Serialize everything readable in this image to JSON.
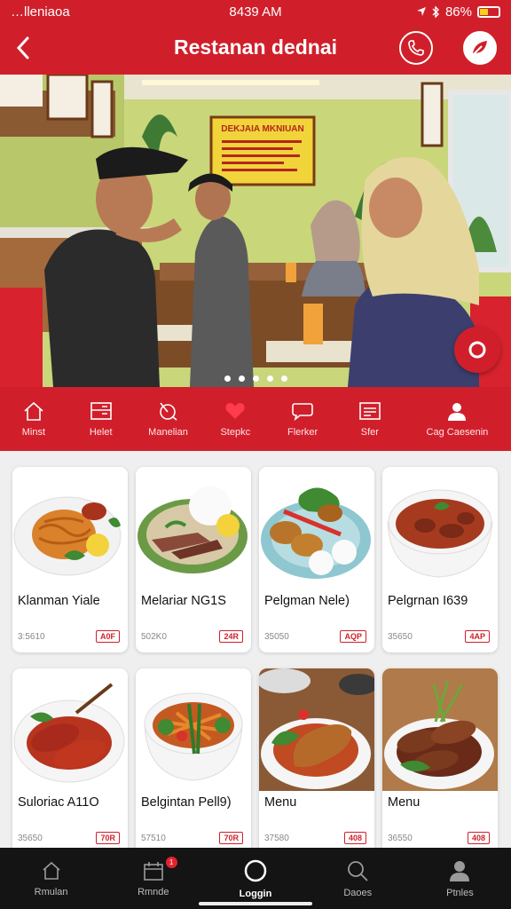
{
  "status_bar": {
    "carrier": "…lleniaoa",
    "time": "8439 AM",
    "battery": "86%"
  },
  "header": {
    "title": "Restanan dednai",
    "back_icon": "chevron-left-icon",
    "phone_icon": "phone-icon",
    "brand_icon": "leaf-badge-icon"
  },
  "hero": {
    "slides": 5,
    "active_slide": 0,
    "menu_board_title": "DEKJAIA MKNIUAN",
    "fab_icon": "refresh-icon"
  },
  "categories": [
    {
      "label": "Minst",
      "icon": "home-icon"
    },
    {
      "label": "Helet",
      "icon": "list-icon"
    },
    {
      "label": "Manelian",
      "icon": "dish-icon"
    },
    {
      "label": "Stepkc",
      "icon": "heart-icon"
    },
    {
      "label": "Flerker",
      "icon": "chat-icon"
    },
    {
      "label": "Sfer",
      "icon": "document-icon"
    },
    {
      "label": "Cag Caesenin",
      "icon": "user-icon"
    }
  ],
  "menu_items": [
    {
      "name": "Klanman Yiale",
      "code": "3:5610",
      "tag": "A0F",
      "dish": "noodles"
    },
    {
      "name": "Melariar NG1S",
      "code": "502K0",
      "tag": "24R",
      "dish": "rice-meat"
    },
    {
      "name": "Pelgman Nele)",
      "code": "35050",
      "tag": "AQP",
      "dish": "satay"
    },
    {
      "name": "Pelgrnan I639",
      "code": "35650",
      "tag": "4AP",
      "dish": "stew"
    },
    {
      "name": "Suloriac A11O",
      "code": "35650",
      "tag": "70R",
      "dish": "sausage"
    },
    {
      "name": "Belgintan Pell9)",
      "code": "57510",
      "tag": "70R",
      "dish": "vegetables"
    },
    {
      "name": "Menu",
      "code": "37580",
      "tag": "408",
      "dish": "grilled"
    },
    {
      "name": "Menu",
      "code": "36550",
      "tag": "408",
      "dish": "rolls"
    }
  ],
  "tab_bar": [
    {
      "label": "Rmulan",
      "icon": "home-icon",
      "badge": ""
    },
    {
      "label": "Rmnde",
      "icon": "calendar-icon",
      "badge": "1"
    },
    {
      "label": "Loggin",
      "icon": "circle-icon",
      "badge": "",
      "active": true
    },
    {
      "label": "Daoes",
      "icon": "search-icon",
      "badge": ""
    },
    {
      "label": "Ptnles",
      "icon": "profile-icon",
      "badge": ""
    }
  ],
  "colors": {
    "brand": "#d01f2b",
    "tabbar": "#141414",
    "background": "#efefef"
  }
}
